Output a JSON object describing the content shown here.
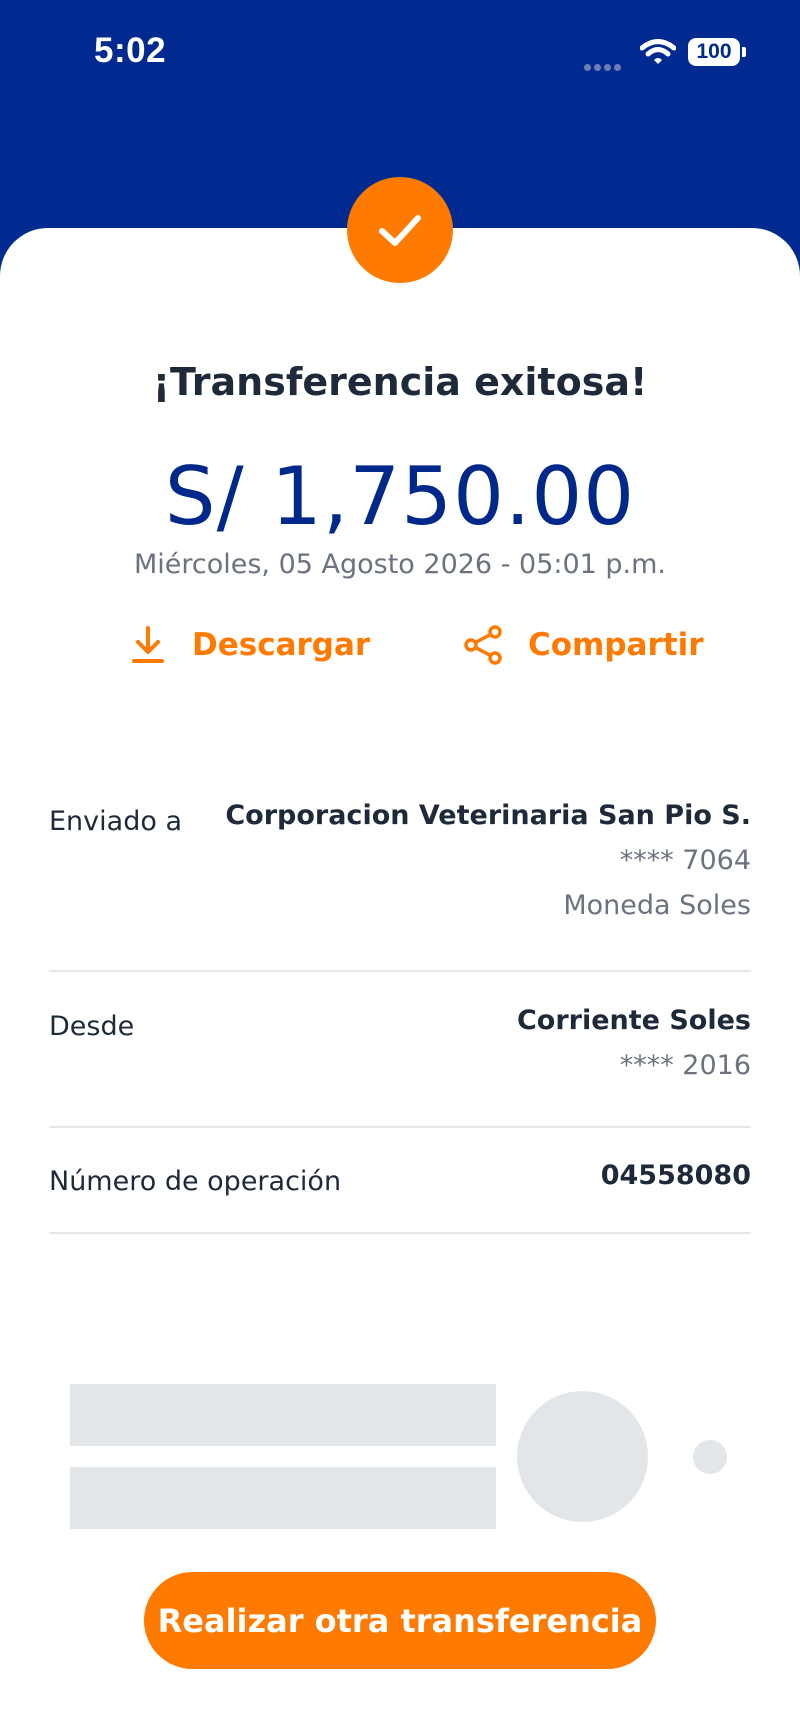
{
  "status_bar": {
    "time": "5:02",
    "battery": "100"
  },
  "confirmation": {
    "title": "¡Transferencia exitosa!",
    "amount": "S/ 1,750.00",
    "date": "Miércoles, 05 Agosto 2026 - 05:01 p.m."
  },
  "actions": {
    "download_label": "Descargar",
    "share_label": "Compartir"
  },
  "details": {
    "sent_to": {
      "label": "Enviado a",
      "name": "Corporacion Veterinaria San Pio S.",
      "account": "**** 7064",
      "currency": "Moneda Soles"
    },
    "from": {
      "label": "Desde",
      "account_type": "Corriente Soles",
      "account": "**** 2016"
    },
    "operation": {
      "label": "Número de operación",
      "number": "04558080"
    }
  },
  "cta": {
    "label": "Realizar otra transferencia"
  },
  "colors": {
    "brand_blue": "#002a8f",
    "accent_orange": "#ff7a00",
    "text_dark": "#1e2a3a",
    "text_muted": "#6b7280"
  },
  "icons": {
    "status": [
      "signal-icon",
      "wifi-icon",
      "battery-icon"
    ],
    "success": "check-icon",
    "download": "download-icon",
    "share": "share-icon"
  }
}
